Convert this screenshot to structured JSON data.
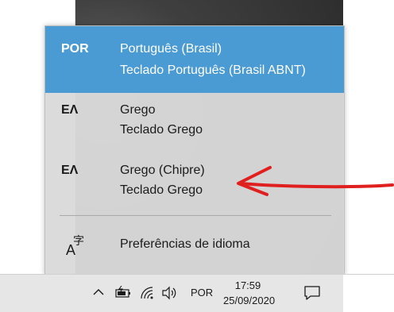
{
  "languages": [
    {
      "code": "POR",
      "name": "Português (Brasil)",
      "keyboard": "Teclado Português (Brasil ABNT)",
      "selected": true
    },
    {
      "code": "ΕΛ",
      "name": "Grego",
      "keyboard": "Teclado Grego",
      "selected": false
    },
    {
      "code": "ΕΛ",
      "name": "Grego (Chipre)",
      "keyboard": "Teclado Grego",
      "selected": false
    }
  ],
  "preferences": {
    "icon_big": "A",
    "icon_small": "字",
    "label": "Preferências de idioma"
  },
  "taskbar": {
    "language_indicator": "POR",
    "time": "17:59",
    "date": "25/09/2020"
  },
  "colors": {
    "selection": "#4a9ad4",
    "annotation_arrow": "#e0201f"
  }
}
